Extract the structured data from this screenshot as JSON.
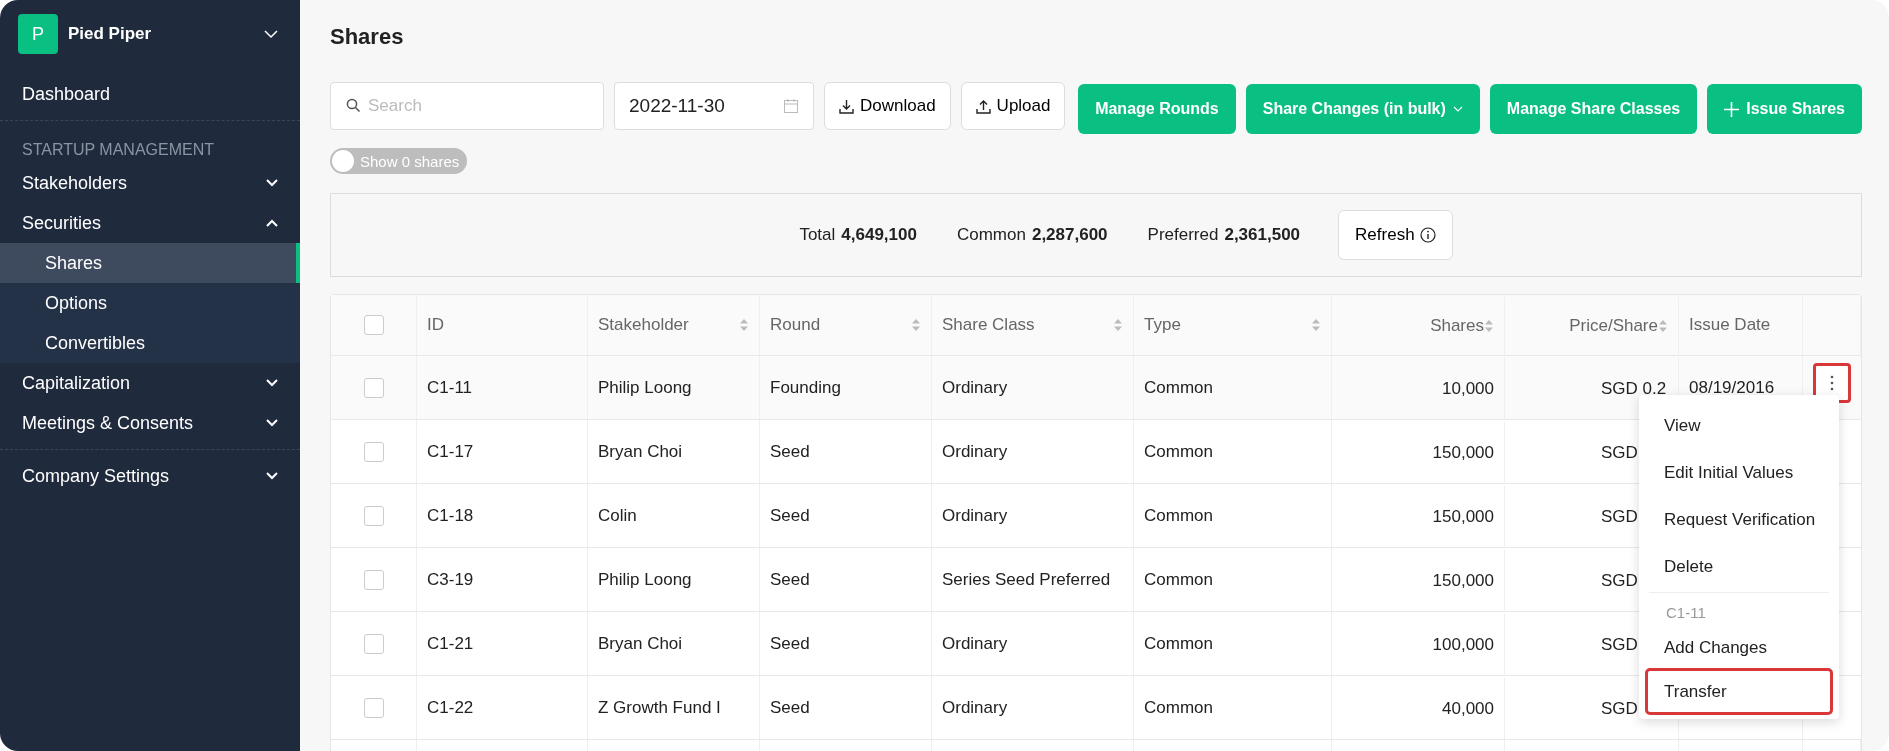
{
  "sidebar": {
    "company": {
      "initial": "P",
      "name": "Pied Piper"
    },
    "groups": [
      {
        "items": [
          {
            "label": "Dashboard",
            "kind": "link",
            "selected": false
          }
        ]
      },
      {
        "label": "STARTUP MANAGEMENT",
        "items": [
          {
            "label": "Stakeholders",
            "kind": "group",
            "expanded": false
          },
          {
            "label": "Securities",
            "kind": "group",
            "expanded": true,
            "children": [
              {
                "label": "Shares",
                "selected": true
              },
              {
                "label": "Options",
                "selected": false
              },
              {
                "label": "Convertibles",
                "selected": false
              }
            ]
          },
          {
            "label": "Capitalization",
            "kind": "group",
            "expanded": false
          },
          {
            "label": "Meetings & Consents",
            "kind": "group",
            "expanded": false
          }
        ]
      },
      {
        "items": [
          {
            "label": "Company Settings",
            "kind": "group",
            "expanded": false
          }
        ]
      }
    ]
  },
  "page_title": "Shares",
  "toolbar": {
    "search": {
      "placeholder": "Search"
    },
    "date": "2022-11-30",
    "download": "Download",
    "upload": "Upload",
    "actions": [
      {
        "label": "Manage Rounds",
        "kind": "plain"
      },
      {
        "label": "Share Changes (in bulk)",
        "kind": "dropdown"
      },
      {
        "label": "Manage Share Classes",
        "kind": "plain"
      },
      {
        "label": "Issue Shares",
        "kind": "add"
      }
    ]
  },
  "toggle": {
    "label": "Show 0 shares",
    "on": false
  },
  "summary": {
    "items": [
      {
        "label": "Total",
        "value": "4,649,100"
      },
      {
        "label": "Common",
        "value": "2,287,600"
      },
      {
        "label": "Preferred",
        "value": "2,361,500"
      }
    ],
    "refresh": "Refresh"
  },
  "table": {
    "all_checked": false,
    "columns": [
      {
        "label": "ID",
        "sortable": false
      },
      {
        "label": "Stakeholder",
        "sortable": true
      },
      {
        "label": "Round",
        "sortable": true
      },
      {
        "label": "Share Class",
        "sortable": true
      },
      {
        "label": "Type",
        "sortable": true
      },
      {
        "label": "Shares",
        "sortable": true
      },
      {
        "label": "Price/Share",
        "sortable": true
      },
      {
        "label": "Issue Date",
        "sortable": false
      }
    ],
    "rows": [
      {
        "checked": false,
        "id": "C1-11",
        "stakeholder": "Philip Loong",
        "round": "Founding",
        "share_class": "Ordinary",
        "type": "Common",
        "shares": "10,000",
        "price": "SGD 0.2",
        "issue_date": "08/19/2016",
        "menu_button": {
          "highlighted": true
        }
      },
      {
        "checked": false,
        "id": "C1-17",
        "stakeholder": "Bryan Choi",
        "round": "Seed",
        "share_class": "Ordinary",
        "type": "Common",
        "shares": "150,000",
        "price": "SGD"
      },
      {
        "checked": false,
        "id": "C1-18",
        "stakeholder": "Colin",
        "round": "Seed",
        "share_class": "Ordinary",
        "type": "Common",
        "shares": "150,000",
        "price": "SGD"
      },
      {
        "checked": false,
        "id": "C3-19",
        "stakeholder": "Philip Loong",
        "round": "Seed",
        "share_class": "Series Seed Preferred",
        "type": "Common",
        "shares": "150,000",
        "price": "SGD"
      },
      {
        "checked": false,
        "id": "C1-21",
        "stakeholder": "Bryan Choi",
        "round": "Seed",
        "share_class": "Ordinary",
        "type": "Common",
        "shares": "100,000",
        "price": "SGD"
      },
      {
        "checked": false,
        "id": "C1-22",
        "stakeholder": "Z Growth Fund I",
        "round": "Seed",
        "share_class": "Ordinary",
        "type": "Common",
        "shares": "40,000",
        "price": "SGD"
      }
    ]
  },
  "row_menu": {
    "items": [
      {
        "label": "View",
        "kind": "item",
        "highlighted": false
      },
      {
        "label": "Edit Initial Values",
        "kind": "item",
        "highlighted": false
      },
      {
        "label": "Request Verification",
        "kind": "item",
        "highlighted": false
      },
      {
        "label": "Delete",
        "kind": "item",
        "highlighted": false
      },
      {
        "kind": "divider"
      },
      {
        "label": "C1-11",
        "kind": "heading"
      },
      {
        "label": "Add Changes",
        "kind": "item",
        "highlighted": false
      },
      {
        "label": "Transfer",
        "kind": "item",
        "highlighted": true
      }
    ]
  }
}
